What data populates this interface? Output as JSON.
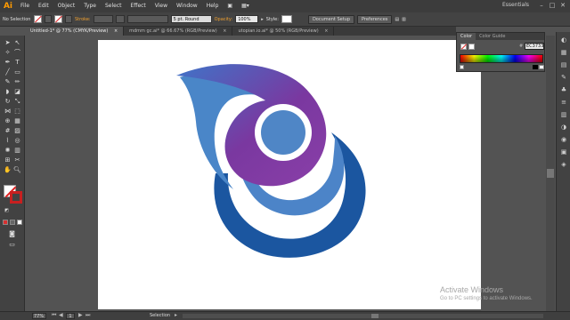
{
  "app": {
    "logo": "Ai",
    "workspace": "Essentials"
  },
  "menu": [
    "File",
    "Edit",
    "Object",
    "Type",
    "Select",
    "Effect",
    "View",
    "Window",
    "Help"
  ],
  "window_controls": [
    "–",
    "□",
    "✕"
  ],
  "control_bar": {
    "selection_state": "No Selection",
    "stroke_label": "Stroke:",
    "brush_value": "5 pt. Round",
    "opacity_label": "Opacity:",
    "opacity_value": "100%",
    "style_label": "Style:",
    "document_setup": "Document Setup",
    "preferences": "Preferences"
  },
  "tabs": [
    {
      "label": "Untitled-1* @ 77% (CMYK/Preview)",
      "active": true
    },
    {
      "label": "mdmm gc.ai* @ 66.67% (RGB/Preview)",
      "active": false
    },
    {
      "label": "utopian.io.ai* @ 50% (RGB/Preview)",
      "active": false
    }
  ],
  "tab_close": "×",
  "color_panel": {
    "tabs": [
      "Color",
      "Color Guide"
    ],
    "hex": "EC3733"
  },
  "status_bar": {
    "zoom": "77%",
    "page": "1",
    "tool": "Selection"
  },
  "watermark": {
    "line1": "Activate Windows",
    "line2": "Go to PC settings to activate Windows."
  },
  "colors": {
    "accent": "#ff9a00",
    "logo_blue_dark": "#1b56a0",
    "logo_blue": "#4c84c8",
    "logo_purple": "#7a38a0"
  }
}
